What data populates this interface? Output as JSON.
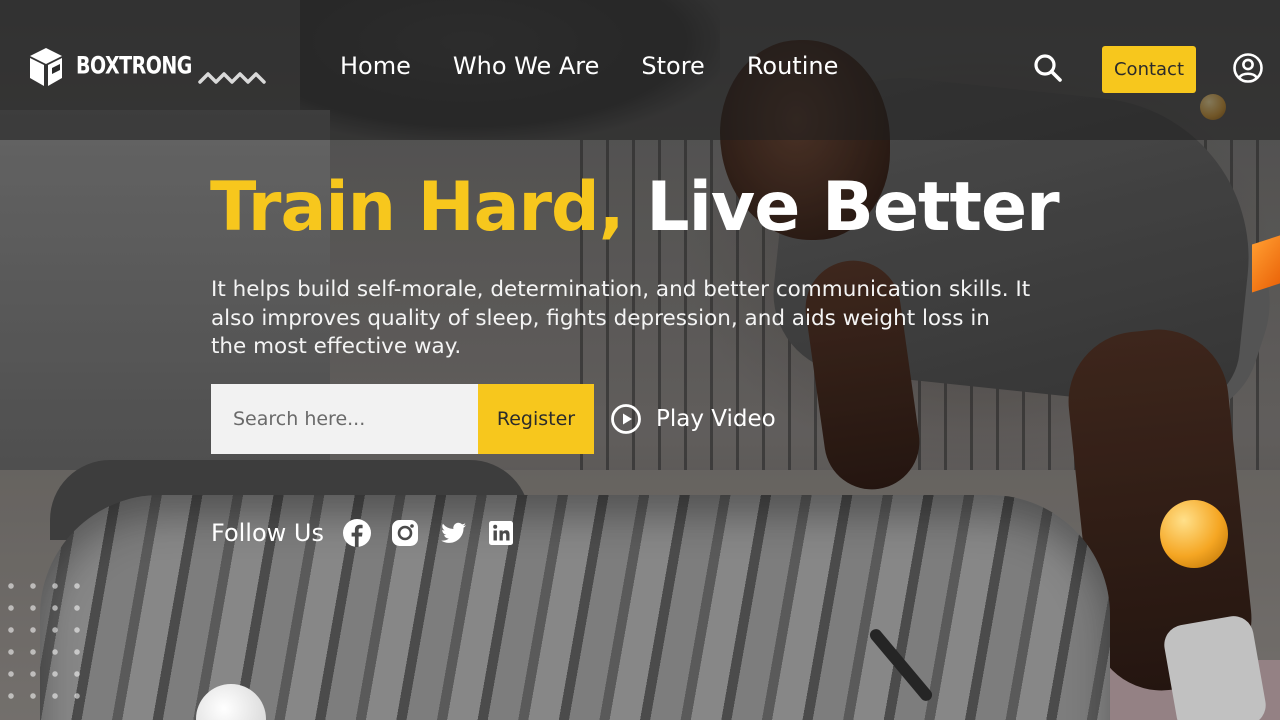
{
  "brand": {
    "name": "BOXTRONG"
  },
  "nav": {
    "items": [
      {
        "label": "Home"
      },
      {
        "label": "Who We Are"
      },
      {
        "label": "Store"
      },
      {
        "label": "Routine"
      }
    ]
  },
  "header": {
    "contact_label": "Contact",
    "search_icon": "search-icon",
    "user_icon": "user-circle-icon"
  },
  "hero": {
    "title_highlight": "Train Hard,",
    "title_rest": "Live Better",
    "description": "It helps build self-morale, determination, and better communication skills. It also improves quality of sleep, fights depression, and aids weight loss in the most effective way.",
    "search_placeholder": "Search here...",
    "register_label": "Register",
    "play_label": "Play Video",
    "play_icon": "play-circle-icon"
  },
  "social": {
    "label": "Follow Us",
    "icons": [
      "facebook-icon",
      "instagram-icon",
      "twitter-icon",
      "linkedin-icon"
    ]
  },
  "colors": {
    "accent": "#f7c71d",
    "text_light": "#ffffff",
    "overlay": "#1e1e1e"
  }
}
